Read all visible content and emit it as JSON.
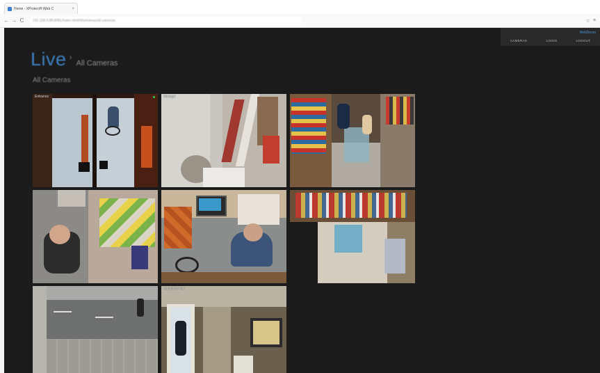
{
  "browser": {
    "tab_title": "Home - XProtect® Web C",
    "tab_close": "×",
    "back": "←",
    "forward": "→",
    "reload": "C",
    "url": "192.168.0.88:8081/index.html#/live/views/all-cameras",
    "star": "☆",
    "menu": "≡"
  },
  "topnav": {
    "user": "WebDemo",
    "items": [
      "CAMERAS",
      "LOGIN",
      "LOGOUT"
    ]
  },
  "header": {
    "title": "Live",
    "separator": "›",
    "subtitle": "All Cameras"
  },
  "section_label": "All Cameras",
  "cameras": [
    {
      "label": "Entrance"
    },
    {
      "label": "Storage"
    },
    {
      "label": ""
    },
    {
      "label": ""
    },
    {
      "label": ""
    },
    {
      "label": ""
    },
    {
      "label": ""
    },
    {
      "label": "Backdoor hall"
    }
  ],
  "colors": {
    "app_background": "#1b1b1b",
    "accent": "#3f7fc0",
    "live_indicator": "#33cc55"
  }
}
